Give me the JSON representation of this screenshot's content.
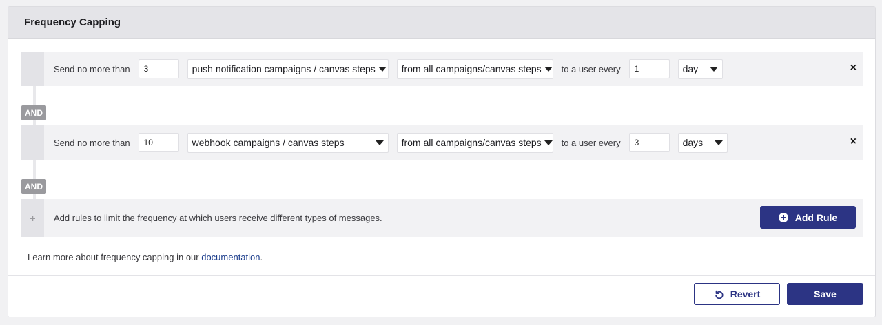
{
  "panel": {
    "title": "Frequency Capping"
  },
  "rules": [
    {
      "prefix": "Send no more than",
      "count": "3",
      "message_type": "push notification campaigns / canvas steps",
      "source": "from all campaigns/canvas steps",
      "interval_label": "to a user every",
      "interval": "1",
      "unit": "day",
      "remove": "×"
    },
    {
      "prefix": "Send no more than",
      "count": "10",
      "message_type": "webhook campaigns / canvas steps",
      "source": "from all campaigns/canvas steps",
      "interval_label": "to a user every",
      "interval": "3",
      "unit": "days",
      "remove": "×"
    }
  ],
  "and_label": "AND",
  "add_row": {
    "handle_icon": "+",
    "description": "Add rules to limit the frequency at which users receive different types of messages.",
    "button_label": "Add Rule"
  },
  "learn_more": {
    "text": "Learn more about frequency capping in our ",
    "link": "documentation",
    "suffix": "."
  },
  "footer": {
    "revert_label": "Revert",
    "save_label": "Save"
  },
  "colors": {
    "primary": "#2c3484",
    "header_bg": "#e4e4e8",
    "row_bg": "#f2f2f4",
    "and_badge": "#9a9a9e",
    "link": "#1c3d8c"
  }
}
